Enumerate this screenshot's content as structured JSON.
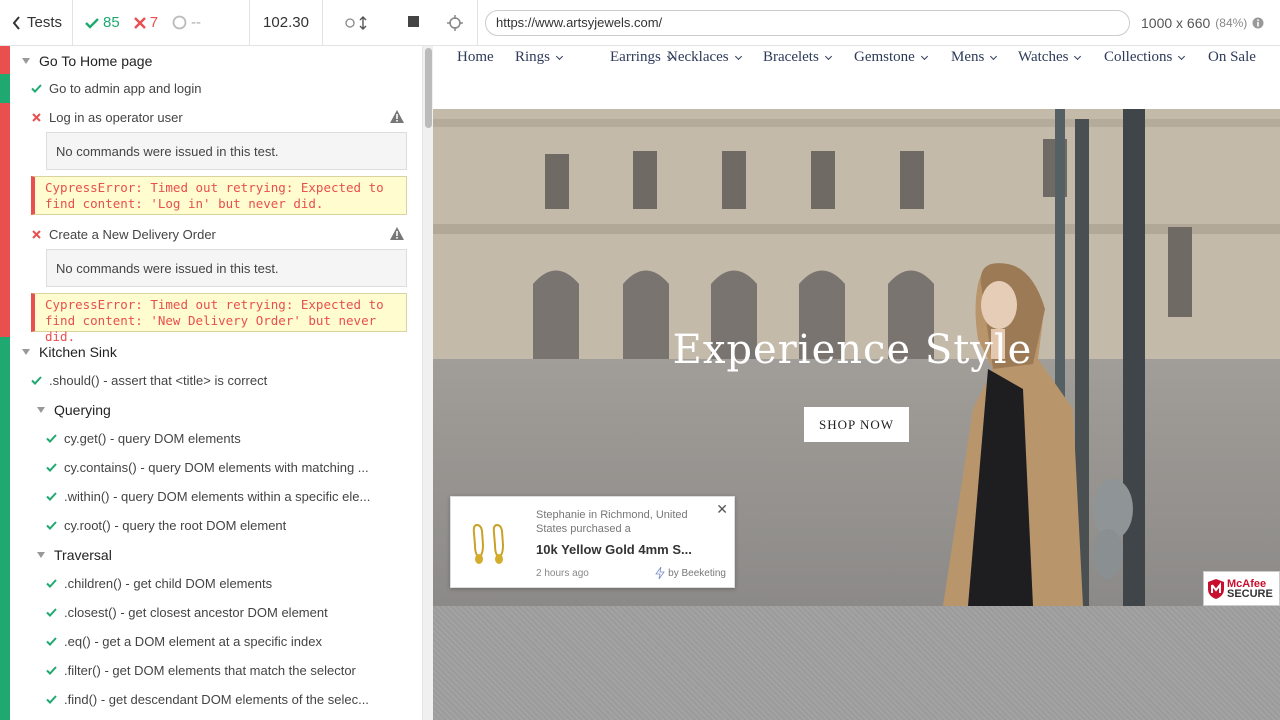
{
  "toolbar": {
    "back_label": "Tests",
    "passed": "85",
    "failed": "7",
    "pending": "--",
    "duration": "102.30"
  },
  "tests": {
    "suite1": {
      "title": "Go To Home page",
      "t1": "Go to admin app and login",
      "t2": "Log in as operator user",
      "t2_cmd": "No commands were issued in this test.",
      "t2_error": "CypressError: Timed out retrying: Expected to find content: 'Log in' but never did.",
      "t3": "Create a New Delivery Order",
      "t3_cmd": "No commands were issued in this test.",
      "t3_error": "CypressError: Timed out retrying: Expected to find content: 'New Delivery Order' but never did."
    },
    "suite2": {
      "title": "Kitchen Sink",
      "t1": ".should() - assert that <title> is correct",
      "querying": {
        "title": "Querying",
        "items": [
          "cy.get() - query DOM elements",
          "cy.contains() - query DOM elements with matching ...",
          ".within() - query DOM elements within a specific ele...",
          "cy.root() - query the root DOM element"
        ]
      },
      "traversal": {
        "title": "Traversal",
        "items": [
          ".children() - get child DOM elements",
          ".closest() - get closest ancestor DOM element",
          ".eq() - get a DOM element at a specific index",
          ".filter() - get DOM elements that match the selector",
          ".find() - get descendant DOM elements of the selec..."
        ]
      }
    }
  },
  "aut": {
    "url": "https://www.artsyjewels.com/",
    "viewport": "1000 x 660",
    "scale": "(84%)",
    "nav": [
      "Home",
      "Rings",
      "Earrings",
      "Necklaces",
      "Bracelets",
      "Gemstone",
      "Mens",
      "Watches",
      "Collections",
      "On Sale"
    ],
    "hero_title": "Experience Style",
    "shop_now": "SHOP NOW",
    "popup": {
      "message": "Stephanie in Richmond, United States purchased a",
      "product": "10k Yellow Gold 4mm S...",
      "time": "2 hours ago",
      "by": "by Beeketing"
    },
    "mcafee_top": "McAfee",
    "mcafee_bottom": "SECURE"
  },
  "colors": {
    "pass": "#1fa971",
    "fail": "#e94f4f",
    "nav_text": "#2d3a59",
    "error_bg": "#fffccf"
  }
}
